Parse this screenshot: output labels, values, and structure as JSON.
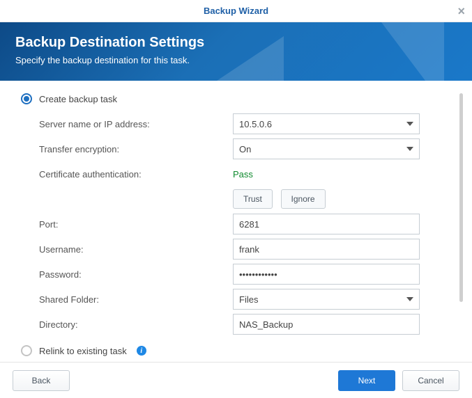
{
  "window": {
    "title": "Backup Wizard"
  },
  "banner": {
    "heading": "Backup Destination Settings",
    "subheading": "Specify the backup destination for this task."
  },
  "options": {
    "create_task_label": "Create backup task",
    "relink_task_label": "Relink to existing task"
  },
  "form": {
    "server_label": "Server name or IP address:",
    "server_value": "10.5.0.6",
    "encryption_label": "Transfer encryption:",
    "encryption_value": "On",
    "cert_auth_label": "Certificate authentication:",
    "cert_auth_status": "Pass",
    "trust_btn": "Trust",
    "ignore_btn": "Ignore",
    "port_label": "Port:",
    "port_value": "6281",
    "username_label": "Username:",
    "username_value": "frank",
    "password_label": "Password:",
    "password_value": "••••••••••••",
    "shared_folder_label": "Shared Folder:",
    "shared_folder_value": "Files",
    "directory_label": "Directory:",
    "directory_value": "NAS_Backup"
  },
  "footer": {
    "back": "Back",
    "next": "Next",
    "cancel": "Cancel"
  }
}
